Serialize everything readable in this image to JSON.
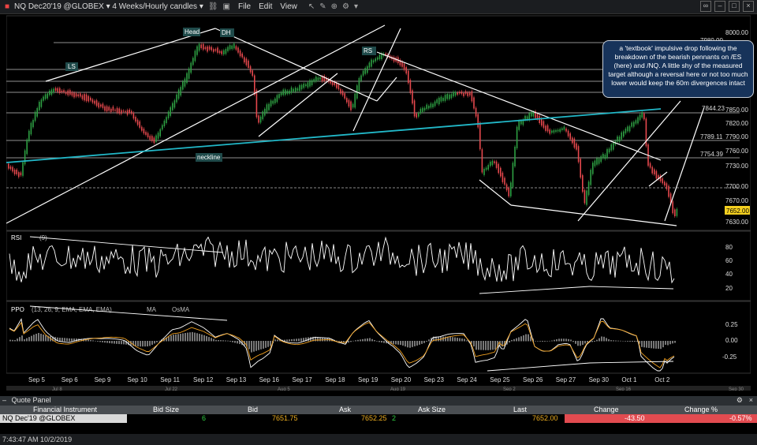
{
  "window": {
    "title": "NQ Dec20'19 @GLOBEX ▾  4 Weeks/Hourly candles ▾",
    "menu": [
      "File",
      "Edit",
      "View"
    ]
  },
  "chart": {
    "symbol_label": "NQ Dec20'19 @GLOBEX",
    "timeframe": "4 Weeks/Hourly candles",
    "price_axis": [
      "8000.00",
      "7980.00",
      "7850.00",
      "7820.00",
      "7790.00",
      "7760.00",
      "7730.00",
      "7700.00",
      "7670.00",
      "7652.00",
      "7630.00"
    ],
    "price_ticks": [
      "8000.00",
      "7980.00",
      "7850.00",
      "7820.00",
      "7790.00",
      "7760.00",
      "7730.00",
      "7700.00",
      "7670.00",
      "7630.00"
    ],
    "level_labels": [
      "7980.00",
      "7844.23",
      "7789.11",
      "7754.39"
    ],
    "last_price_tag": "7652.00",
    "annotations": {
      "head": "Head",
      "dh": "DH",
      "ls": "LS",
      "rs": "RS",
      "neckline": "neckline"
    },
    "note": "a 'textbook' impulsive drop following the breakdown of the bearish pennants on /ES (here) and /NQ. A little shy of the measured target although a reversal here or not too much lower would keep the 60m divergences intact",
    "rsi": {
      "label": "RSI",
      "params": "(9)",
      "ticks": [
        "80",
        "60",
        "40",
        "20"
      ]
    },
    "ppo": {
      "label": "PPO",
      "params": "(13, 26, 9, EMA, EMA, EMA)",
      "ma": "MA",
      "osma": "OsMA",
      "ticks": [
        "0.25",
        "0.00",
        "-0.25"
      ]
    },
    "x_axis": [
      "Sep 5",
      "Sep 6",
      "Sep 9",
      "Sep 10",
      "Sep 11",
      "Sep 12",
      "Sep 13",
      "Sep 16",
      "Sep 17",
      "Sep 18",
      "Sep 19",
      "Sep 20",
      "Sep 23",
      "Sep 24",
      "Sep 25",
      "Sep 26",
      "Sep 27",
      "Sep 30",
      "Oct 1",
      "Oct 2"
    ],
    "overview_axis": [
      "Jul 8",
      "Jul 22",
      "Aug 5",
      "Aug 19",
      "Sep 2",
      "Sep 16",
      "Sep 30"
    ],
    "colors": {
      "up": "#2ea043",
      "down": "#e5484d",
      "neckline": "#22b8c8",
      "trend": "#ffffff"
    }
  },
  "quote_panel": {
    "header": "Quote Panel",
    "columns": [
      "Financial Instrument",
      "Bid Size",
      "Bid",
      "Ask",
      "Ask Size",
      "Last",
      "Change",
      "Change %"
    ],
    "row": {
      "instrument": "NQ Dec'19 @GLOBEX",
      "bid_size": "6",
      "bid": "7651.75",
      "ask": "7652.25",
      "ask_size": "2",
      "last": "7652.00",
      "change": "-43.50",
      "change_pct": "-0.57%"
    }
  },
  "status": {
    "time": "7:43:47 AM 10/2/2019"
  }
}
